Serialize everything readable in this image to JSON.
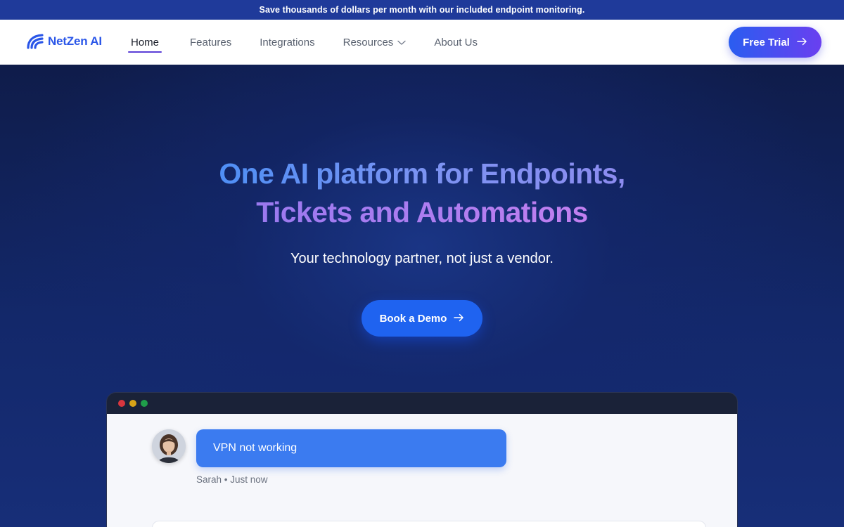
{
  "announcement": {
    "text": "Save thousands of dollars per month with our included endpoint monitoring."
  },
  "header": {
    "brand": "NetZen AI",
    "nav": [
      {
        "label": "Home",
        "active": true
      },
      {
        "label": "Features"
      },
      {
        "label": "Integrations"
      },
      {
        "label": "Resources",
        "has_dropdown": true
      },
      {
        "label": "About Us"
      }
    ],
    "cta_label": "Free Trial"
  },
  "hero": {
    "title_line1": "One AI platform for Endpoints,",
    "title_line2": "Tickets and Automations",
    "subtitle": "Your technology partner, not just a vendor.",
    "cta_label": "Book a Demo"
  },
  "preview": {
    "message": "VPN not working",
    "author": "Sarah",
    "time": "Just now",
    "meta": "Sarah • Just now"
  },
  "colors": {
    "brand_blue": "#2a56e8",
    "announce_bg": "#1f3a9a",
    "cta_blue": "#1f63f0",
    "gradient_purple": "#6a3ff0",
    "hero_bg": "#13286a"
  },
  "icons": [
    "netzen-logo-icon",
    "chevron-down-icon",
    "arrow-right-icon",
    "avatar-photo"
  ]
}
